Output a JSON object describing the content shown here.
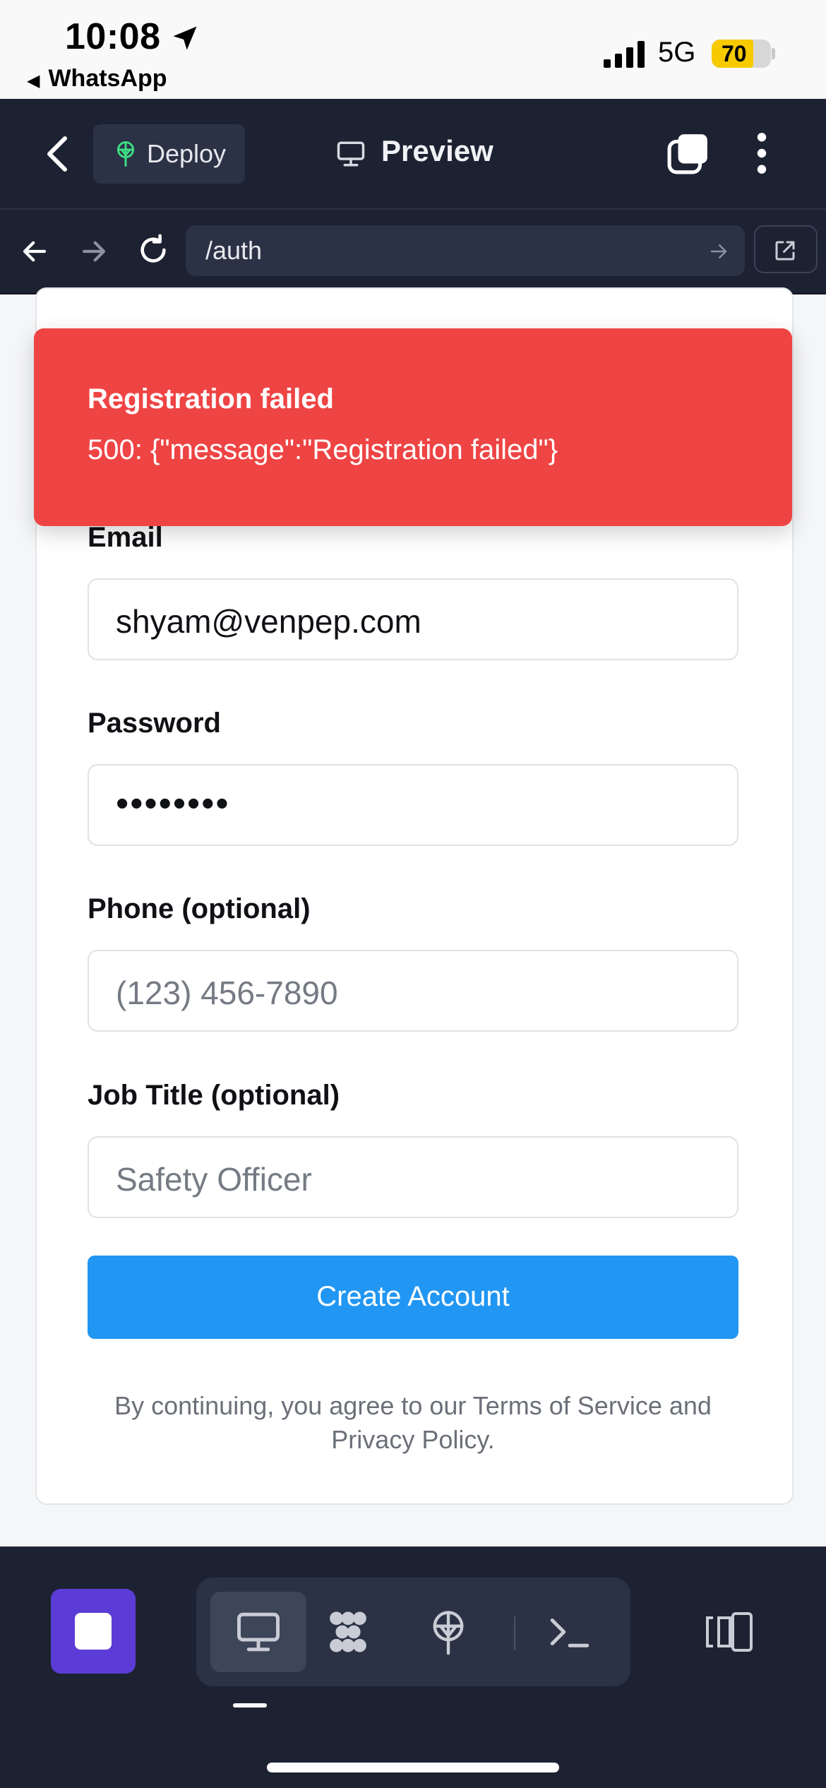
{
  "status_bar": {
    "time": "10:08",
    "back_app": "WhatsApp",
    "network": "5G",
    "battery": "70",
    "battery_level_pct": 70,
    "battery_color": "#f7ca00"
  },
  "topbar": {
    "deploy_label": "Deploy",
    "title": "Preview"
  },
  "urlbar": {
    "url": "/auth"
  },
  "toast": {
    "title": "Registration failed",
    "message": "500: {\"message\":\"Registration failed\"}",
    "color": "#ef4444"
  },
  "form": {
    "email_label": "Email",
    "email_value": "shyam@venpep.com",
    "password_label": "Password",
    "password_value": "••••••••",
    "phone_label": "Phone (optional)",
    "phone_placeholder": "(123) 456-7890",
    "job_label": "Job Title (optional)",
    "job_placeholder": "Safety Officer",
    "submit_label": "Create Account",
    "submit_color": "#2196f3",
    "legal_text": "By continuing, you agree to our Terms of Service and Privacy Policy."
  },
  "bottombar": {
    "tools": [
      "monitor-icon",
      "integrations-icon",
      "deploy-icon",
      "terminal-icon"
    ],
    "active_tool": "monitor-icon",
    "stop_color": "#5b3cd6"
  }
}
